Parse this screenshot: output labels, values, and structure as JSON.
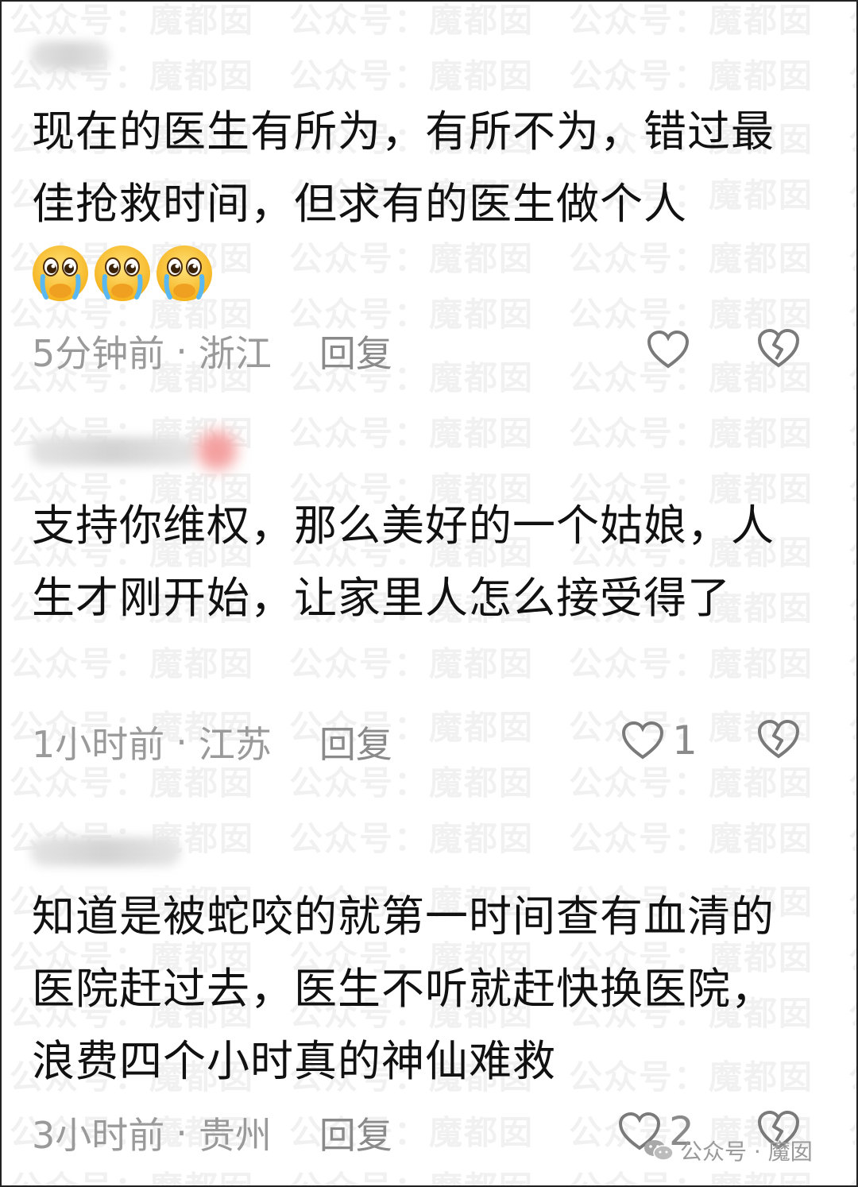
{
  "watermark_text": "公众号：魔都囡",
  "comments": [
    {
      "text": "现在的医生有所为，有所不为，错过最佳抢救时间，但求有的医生做个人",
      "emoji_count": 3,
      "time": "5分钟前",
      "location": "浙江",
      "reply_label": "回复",
      "likes": ""
    },
    {
      "text": "支持你维权，那么美好的一个姑娘，人生才刚开始，让家里人怎么接受得了",
      "emoji_count": 0,
      "time": "1小时前",
      "location": "江苏",
      "reply_label": "回复",
      "likes": "1"
    },
    {
      "text": "知道是被蛇咬的就第一时间查有血清的医院赶过去，医生不听就赶快换医院，浪费四个小时真的神仙难救",
      "emoji_count": 0,
      "time": "3小时前",
      "location": "贵州",
      "reply_label": "回复",
      "likes": "2"
    }
  ],
  "footer": {
    "label": "公众号 · 魔囡"
  },
  "colors": {
    "text": "#111111",
    "meta": "#9a9a9a",
    "badge": "#f4a0a0"
  }
}
